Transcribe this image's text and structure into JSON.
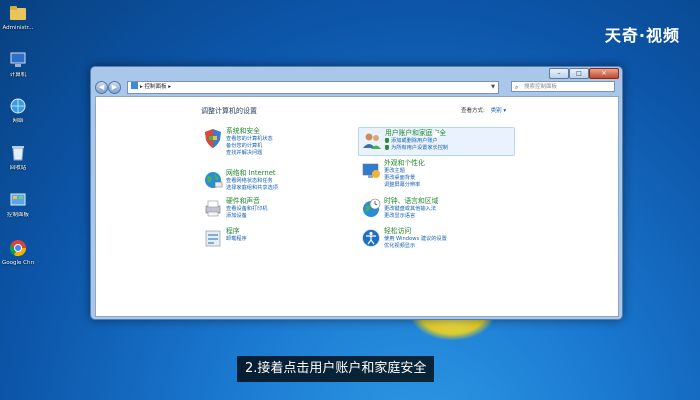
{
  "watermark": "天奇·视频",
  "desktop": {
    "icons": [
      {
        "label": "Administr...",
        "icon": "folder-icon"
      },
      {
        "label": "计算机",
        "icon": "computer-icon"
      },
      {
        "label": "网络",
        "icon": "network-icon"
      },
      {
        "label": "回收站",
        "icon": "recycle-bin-icon"
      },
      {
        "label": "控制面板",
        "icon": "control-panel-icon"
      },
      {
        "label": "Google Chrome",
        "icon": "chrome-icon"
      }
    ]
  },
  "window": {
    "address": "控制面板",
    "search_placeholder": "搜索控制面板",
    "page_title": "调整计算机的设置",
    "view_by_label": "查看方式:",
    "view_by_value": "类别",
    "categories": [
      {
        "head": "系统和安全",
        "links": [
          "查看您的计算机状态",
          "备份您的计算机",
          "查找并解决问题"
        ],
        "icon": "shield-icon"
      },
      {
        "head": "网络和 Internet",
        "links": [
          "查看网络状态和任务",
          "选择家庭组和共享选项"
        ],
        "icon": "network-globe-icon"
      },
      {
        "head": "硬件和声音",
        "links": [
          "查看设备和打印机",
          "添加设备"
        ],
        "icon": "printer-icon"
      },
      {
        "head": "程序",
        "links": [
          "卸载程序"
        ],
        "icon": "programs-icon"
      },
      {
        "head": "用户账户和家庭安全",
        "links": [
          "添加或删除用户账户",
          "为所有用户设置家长控制"
        ],
        "icon": "users-icon"
      },
      {
        "head": "外观和个性化",
        "links": [
          "更改主题",
          "更改桌面背景",
          "调整屏幕分辨率"
        ],
        "icon": "appearance-icon"
      },
      {
        "head": "时钟、语言和区域",
        "links": [
          "更改键盘或其他输入法",
          "更改显示语言"
        ],
        "icon": "clock-globe-icon"
      },
      {
        "head": "轻松访问",
        "links": [
          "使用 Windows 建议的设置",
          "优化视频显示"
        ],
        "icon": "ease-of-access-icon"
      }
    ]
  },
  "caption": "2.接着点击用户账户和家庭安全"
}
